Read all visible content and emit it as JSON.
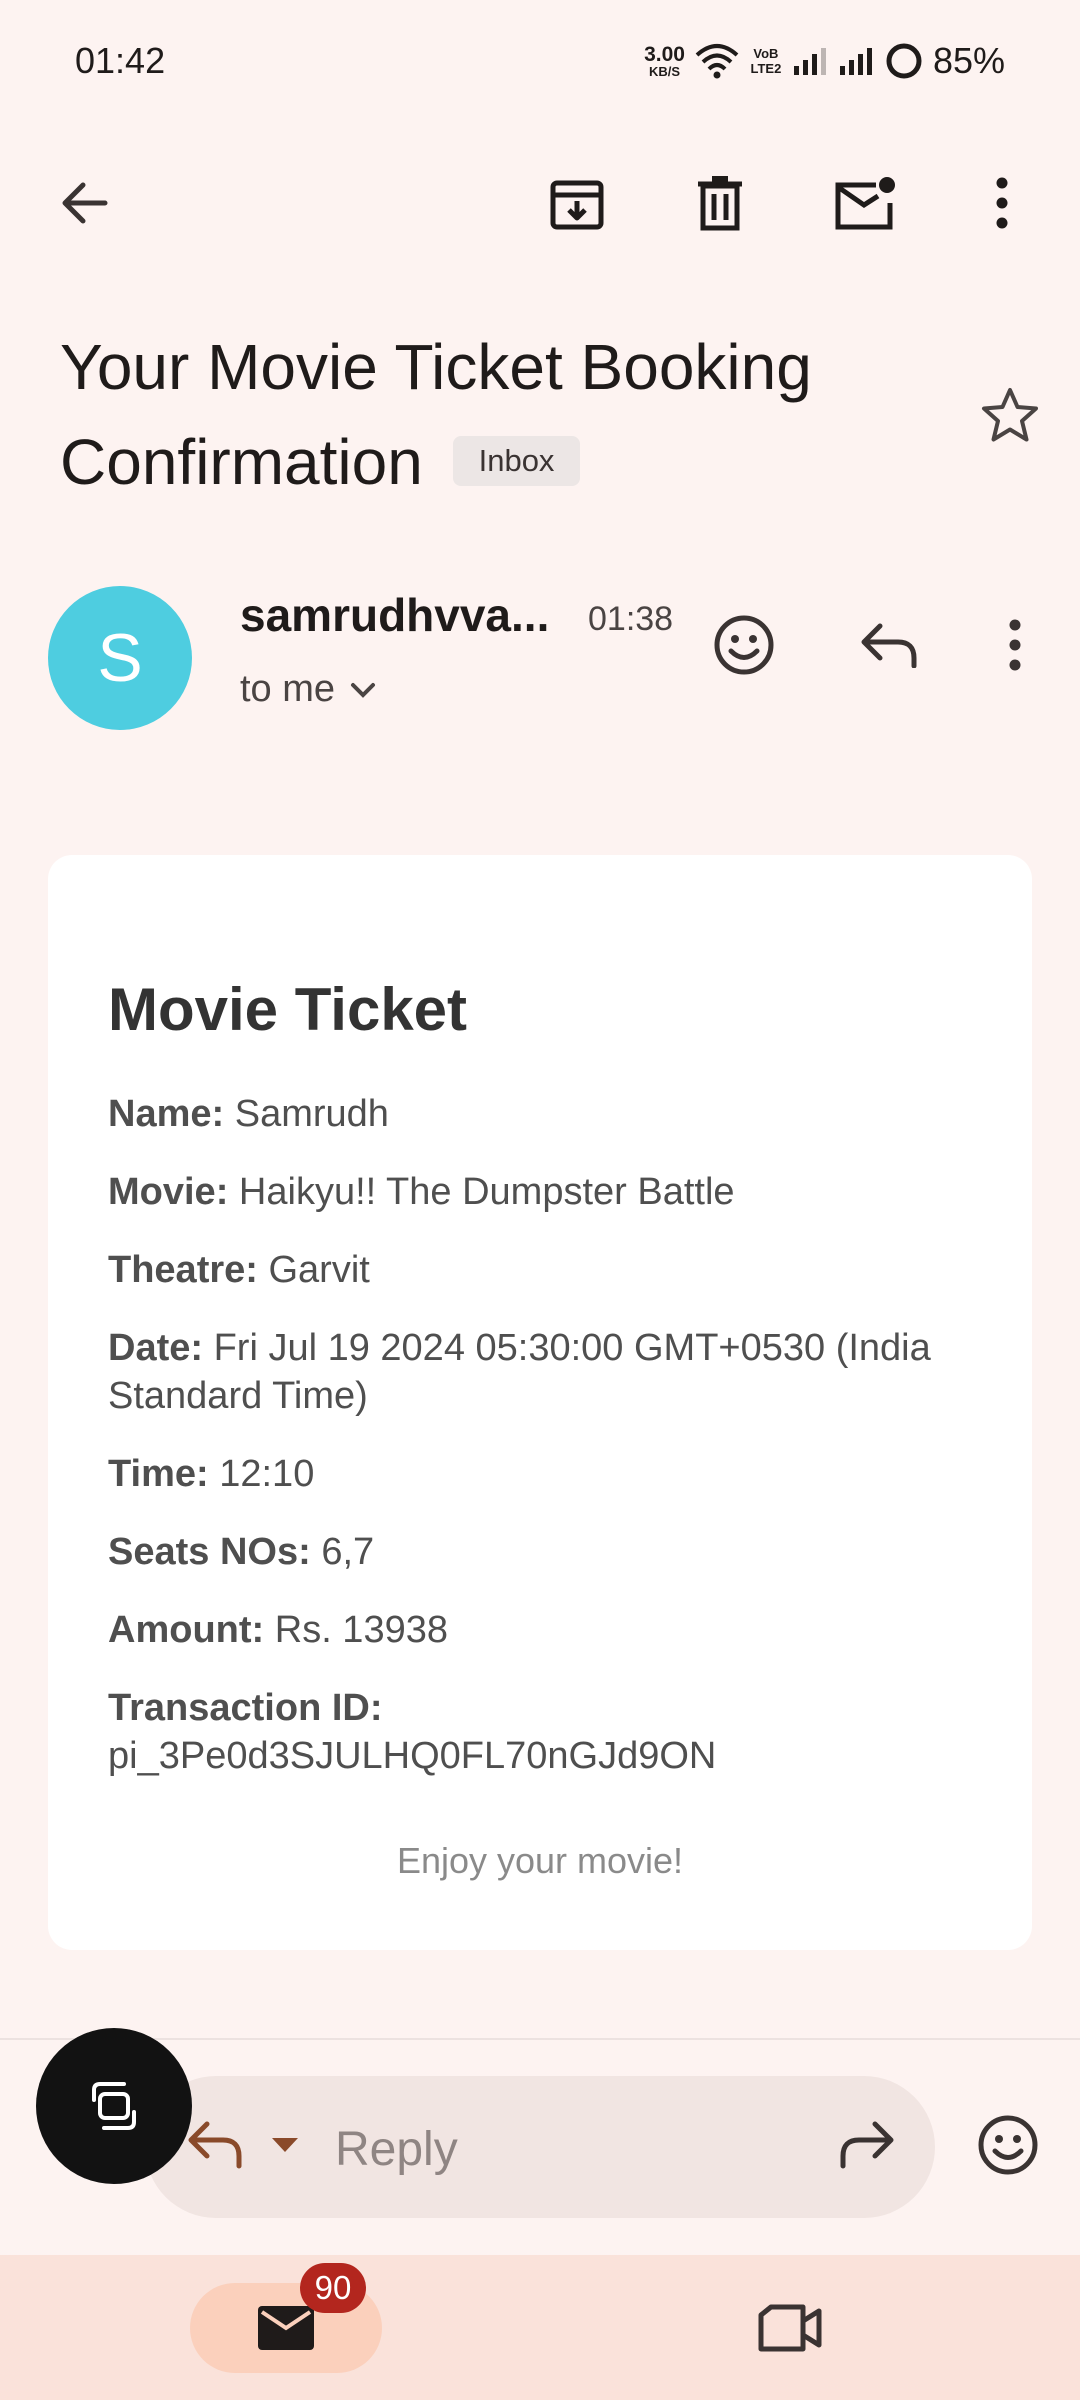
{
  "status_bar": {
    "time": "01:42",
    "net_speed_value": "3.00",
    "net_speed_unit": "KB/S",
    "volte_top": "VoB",
    "volte_bottom": "LTE2",
    "battery": "85%"
  },
  "toolbar": {
    "back_icon": "arrow-back-icon",
    "archive_icon": "archive-icon",
    "delete_icon": "trash-icon",
    "mark_unread_icon": "mark-unread-icon",
    "more_icon": "more-vert-icon"
  },
  "email": {
    "subject": "Your Movie Ticket Booking Confirmation",
    "label": "Inbox",
    "sender_initial": "S",
    "sender_name": "samrudhvva...",
    "time": "01:38",
    "recipient": "to me",
    "avatar_color": "#4ecde0"
  },
  "ticket": {
    "title": "Movie Ticket",
    "fields": [
      {
        "label": "Name:",
        "value": "Samrudh"
      },
      {
        "label": "Movie:",
        "value": "Haikyu!! The Dumpster Battle"
      },
      {
        "label": "Theatre:",
        "value": "Garvit"
      },
      {
        "label": "Date:",
        "value": "Fri Jul 19 2024 05:30:00 GMT+0530 (India Standard Time)"
      },
      {
        "label": "Time:",
        "value": "12:10"
      },
      {
        "label": "Seats NOs:",
        "value": "6,7"
      },
      {
        "label": "Amount:",
        "value": "Rs. 13938"
      },
      {
        "label": "Transaction ID:",
        "value": "pi_3Pe0d3SJULHQ0FL70nGJd9ON"
      }
    ],
    "footer": "Enjoy your movie!"
  },
  "reply_bar": {
    "placeholder": "Reply"
  },
  "bottom_nav": {
    "mail_badge": "90"
  },
  "colors": {
    "background": "#fdf3f1",
    "accent": "#8a4a2a",
    "badge": "#b3261e"
  }
}
